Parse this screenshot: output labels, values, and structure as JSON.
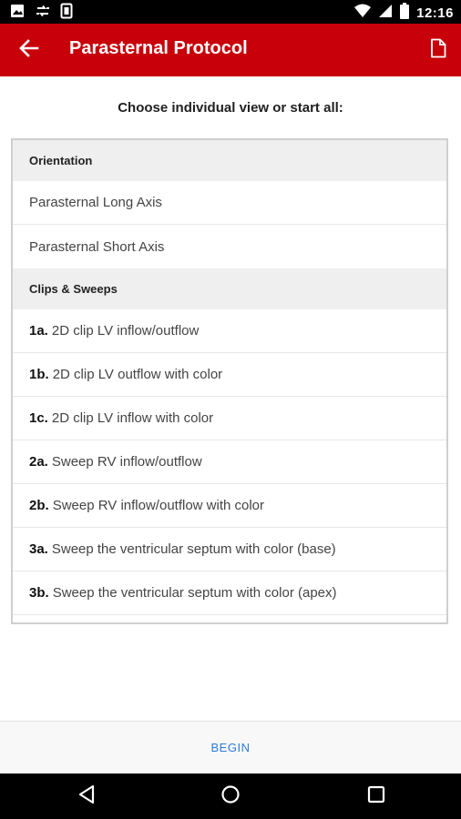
{
  "status_bar": {
    "time": "12:16",
    "left_icons": [
      "photo-icon",
      "sync-icon",
      "sim-icon"
    ],
    "right_icons": [
      "wifi-icon",
      "cell-signal-icon",
      "battery-icon"
    ]
  },
  "app_bar": {
    "title": "Parasternal Protocol",
    "back_icon": "arrow-left-icon",
    "action_icon": "document-icon",
    "color": "#c8000a"
  },
  "prompt": "Choose individual view or start all:",
  "sections": [
    {
      "header": "Orientation",
      "items": [
        {
          "num": "",
          "label": "Parasternal Long Axis"
        },
        {
          "num": "",
          "label": "Parasternal Short Axis"
        }
      ]
    },
    {
      "header": "Clips & Sweeps",
      "items": [
        {
          "num": "1a.",
          "label": "2D clip LV inflow/outflow"
        },
        {
          "num": "1b.",
          "label": "2D clip LV outflow with color"
        },
        {
          "num": "1c.",
          "label": "2D clip LV inflow with color"
        },
        {
          "num": "2a.",
          "label": "Sweep RV inflow/outflow"
        },
        {
          "num": "2b.",
          "label": "Sweep RV inflow/outflow with color"
        },
        {
          "num": "3a.",
          "label": "Sweep the ventricular septum with color (base)"
        },
        {
          "num": "3b.",
          "label": "Sweep the ventricular septum with color (apex)"
        }
      ]
    }
  ],
  "bottom": {
    "begin_label": "BEGIN",
    "accent": "#2e7bd6"
  },
  "nav_bar": {
    "icons": [
      "back-triangle-icon",
      "home-circle-icon",
      "recents-square-icon"
    ]
  }
}
